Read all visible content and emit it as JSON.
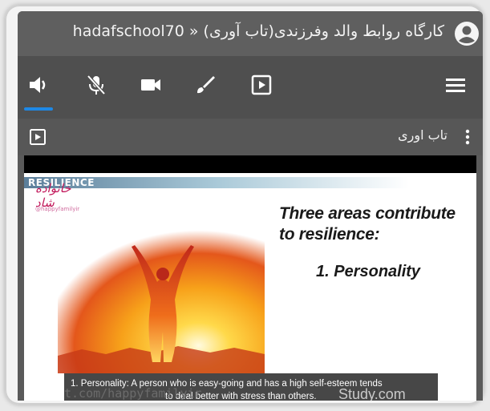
{
  "app": {
    "title": "hadafschool70 » کارگاه روابط والد وفرزندی(تاب آوری)"
  },
  "toolbar": {
    "buttons": [
      {
        "name": "volume-icon",
        "active": true
      },
      {
        "name": "mic-off-icon",
        "active": false
      },
      {
        "name": "video-camera-icon",
        "active": false
      },
      {
        "name": "brush-icon",
        "active": false
      },
      {
        "name": "play-box-icon",
        "active": false
      },
      {
        "name": "menu-icon",
        "active": false
      }
    ],
    "accent": "#1e88e5"
  },
  "content": {
    "title": "تاب اوری"
  },
  "slide": {
    "banner": "RESILIENCE",
    "logo_text": "خانواده شاد",
    "handle": "@happyfamilyir",
    "headline": "Three areas contribute to resilience:",
    "point": "1. Personality",
    "watermark_url": "t.com/happyfamilyir",
    "watermark_site": "Study.com",
    "caption_line1": "1. Personality: A person who is easy-going and has a high self-esteem tends",
    "caption_line2": "to deal better with stress than others."
  }
}
